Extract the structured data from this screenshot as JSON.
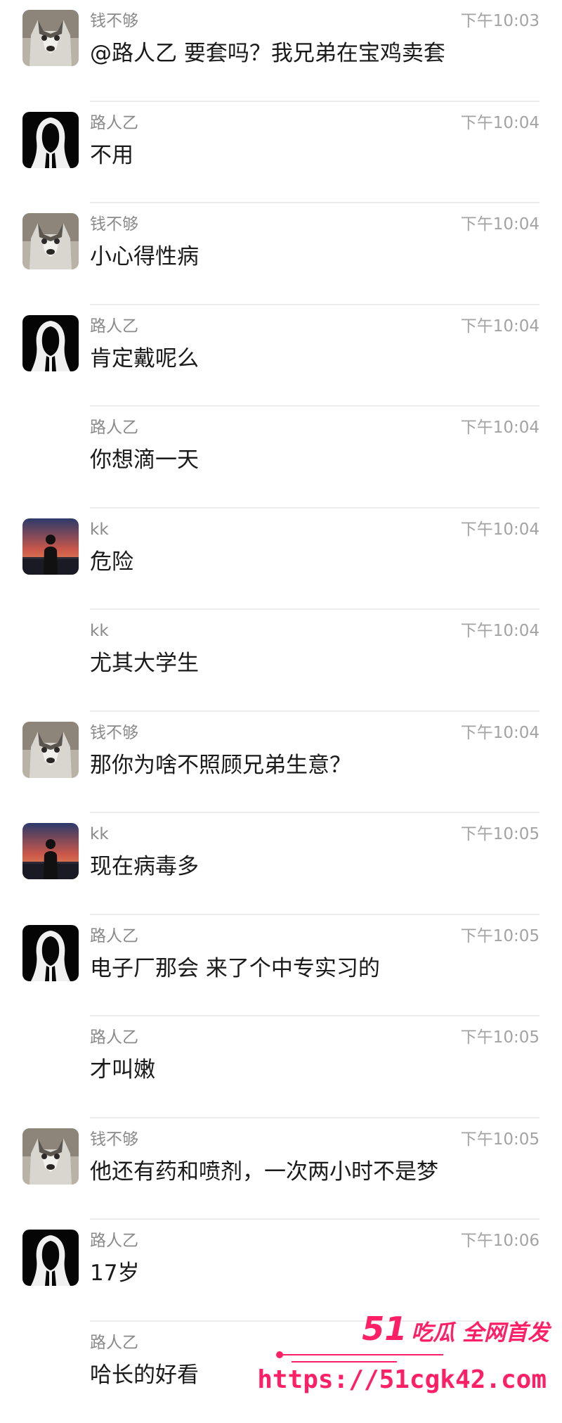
{
  "messages": [
    {
      "sender": "钱不够",
      "avatar": "husky",
      "time": "下午10:03",
      "text": "@路人乙 要套吗？我兄弟在宝鸡卖套"
    },
    {
      "sender": "路人乙",
      "avatar": "hooded",
      "time": "下午10:04",
      "text": "不用"
    },
    {
      "sender": "钱不够",
      "avatar": "husky",
      "time": "下午10:04",
      "text": "小心得性病"
    },
    {
      "sender": "路人乙",
      "avatar": "hooded",
      "time": "下午10:04",
      "text": "肯定戴呢么"
    },
    {
      "sender": "路人乙",
      "avatar": "",
      "time": "下午10:04",
      "text": "你想滴一天"
    },
    {
      "sender": "kk",
      "avatar": "sunset",
      "time": "下午10:04",
      "text": "危险"
    },
    {
      "sender": "kk",
      "avatar": "",
      "time": "下午10:04",
      "text": "尤其大学生"
    },
    {
      "sender": "钱不够",
      "avatar": "husky",
      "time": "下午10:04",
      "text": "那你为啥不照顾兄弟生意？"
    },
    {
      "sender": "kk",
      "avatar": "sunset",
      "time": "下午10:05",
      "text": "现在病毒多"
    },
    {
      "sender": "路人乙",
      "avatar": "hooded",
      "time": "下午10:05",
      "text": "电子厂那会   来了个中专实习的"
    },
    {
      "sender": "路人乙",
      "avatar": "",
      "time": "下午10:05",
      "text": "才叫嫩"
    },
    {
      "sender": "钱不够",
      "avatar": "husky",
      "time": "下午10:05",
      "text": "他还有药和喷剂，一次两小时不是梦"
    },
    {
      "sender": "路人乙",
      "avatar": "hooded",
      "time": "下午10:06",
      "text": "17岁"
    },
    {
      "sender": "路人乙",
      "avatar": "",
      "time": "",
      "text": "哈长的好看"
    }
  ],
  "watermark": {
    "number": "51",
    "tagline": "吃瓜 全网首发",
    "url": "https://51cgk42.com",
    "color": "#ff1f66"
  }
}
